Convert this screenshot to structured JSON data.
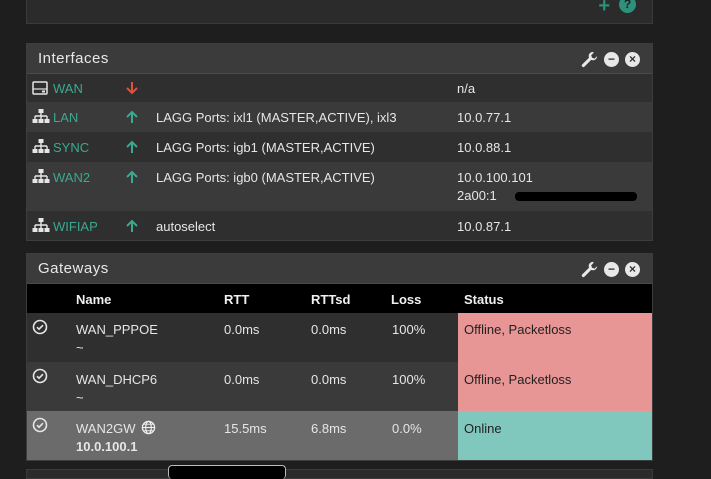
{
  "interfaces": {
    "title": "Interfaces",
    "rows": [
      {
        "name": "WAN",
        "icon": "ethernet-port-icon",
        "status": "down",
        "media": "",
        "ip": "n/a",
        "ip2": ""
      },
      {
        "name": "LAN",
        "icon": "network-tree-icon",
        "status": "up",
        "media": "LAGG Ports: ixl1 (MASTER,ACTIVE), ixl3",
        "ip": "10.0.77.1",
        "ip2": ""
      },
      {
        "name": "SYNC",
        "icon": "network-tree-icon",
        "status": "up",
        "media": "LAGG Ports: igb1 (MASTER,ACTIVE)",
        "ip": "10.0.88.1",
        "ip2": ""
      },
      {
        "name": "WAN2",
        "icon": "network-tree-icon",
        "status": "up",
        "media": "LAGG Ports: igb0 (MASTER,ACTIVE)",
        "ip": "10.0.100.101",
        "ip2": "2a00:1"
      },
      {
        "name": "WIFIAP",
        "icon": "network-tree-icon",
        "status": "up",
        "media": "autoselect",
        "ip": "10.0.87.1",
        "ip2": ""
      }
    ]
  },
  "gateways": {
    "title": "Gateways",
    "columns": {
      "name": "Name",
      "rtt": "RTT",
      "rttsd": "RTTsd",
      "loss": "Loss",
      "status": "Status"
    },
    "rows": [
      {
        "name": "WAN_PPPOE",
        "sub": "~",
        "rtt": "0.0ms",
        "rttsd": "0.0ms",
        "loss": "100%",
        "status": "Offline, Packetloss",
        "state": "offline"
      },
      {
        "name": "WAN_DHCP6",
        "sub": "~",
        "rtt": "0.0ms",
        "rttsd": "0.0ms",
        "loss": "100%",
        "status": "Offline, Packetloss",
        "state": "offline"
      },
      {
        "name": "WAN2GW",
        "sub": "10.0.100.1",
        "rtt": "15.5ms",
        "rttsd": "6.8ms",
        "loss": "0.0%",
        "status": "Online",
        "state": "online"
      }
    ]
  },
  "colors": {
    "accent": "#3aa98f",
    "up_arrow": "#3aa98f",
    "down_arrow": "#e0513c",
    "offline": "#e89595",
    "online": "#80c8bd"
  }
}
